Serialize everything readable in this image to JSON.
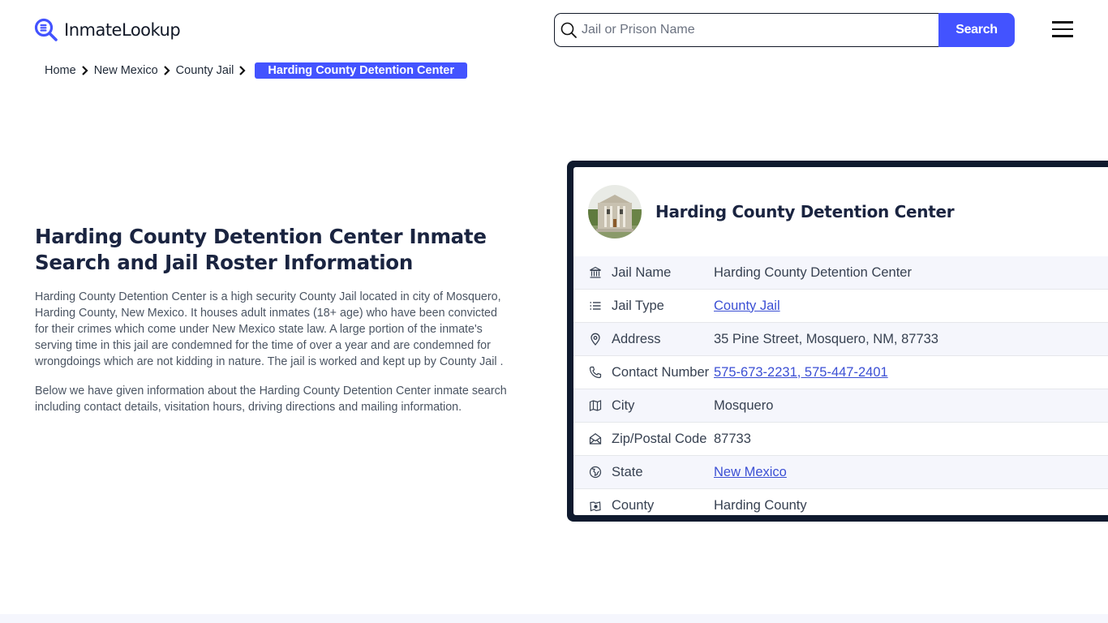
{
  "header": {
    "logo_text": "InmateLookup",
    "search": {
      "placeholder": "Jail or Prison Name",
      "value": "",
      "button_label": "Search"
    },
    "menu_icon": "hamburger-menu-icon"
  },
  "breadcrumb": {
    "items": [
      {
        "label": "Home"
      },
      {
        "label": "New Mexico"
      },
      {
        "label": "County Jail"
      }
    ],
    "active": "Harding County Detention Center"
  },
  "intro": {
    "title": "Harding County Detention Center Inmate Search and Jail Roster Information",
    "paragraphs": [
      "Harding County Detention Center is a high security County Jail located in city of Mosquero, Harding County, New Mexico. It houses adult inmates (18+ age) who have been convicted for their crimes which come under New Mexico state law. A large portion of the inmate's serving time in this jail are condemned for the time of over a year and are condemned for wrongdoings which are not kidding in nature. The jail is worked and kept up by County Jail .",
      "Below we have given information about the Harding County Detention Center inmate search including contact details, visitation hours, driving directions and mailing information."
    ]
  },
  "card": {
    "title": "Harding County Detention Center",
    "rows": [
      {
        "icon": "building-columns-icon",
        "label": "Jail Name",
        "value": "Harding County Detention Center",
        "link": false
      },
      {
        "icon": "list-icon",
        "label": "Jail Type",
        "value": "County Jail",
        "link": true
      },
      {
        "icon": "map-pin-icon",
        "label": "Address",
        "value": "35 Pine Street, Mosquero, NM, 87733",
        "link": false
      },
      {
        "icon": "phone-icon",
        "label": "Contact Number",
        "value": "575-673-2231, 575-447-2401",
        "link": true
      },
      {
        "icon": "map-icon",
        "label": "City",
        "value": "Mosquero",
        "link": false
      },
      {
        "icon": "mail-open-icon",
        "label": "Zip/Postal Code",
        "value": "87733",
        "link": false
      },
      {
        "icon": "globe-icon",
        "label": "State",
        "value": "New Mexico",
        "link": true
      },
      {
        "icon": "county-map-icon",
        "label": "County",
        "value": "Harding County",
        "link": false
      }
    ]
  },
  "colors": {
    "accent": "#4353ff",
    "card_border": "#0f1a2e",
    "heading": "#1a2440",
    "link": "#3b4fd4",
    "row_alt_bg": "#f5f6fc"
  }
}
